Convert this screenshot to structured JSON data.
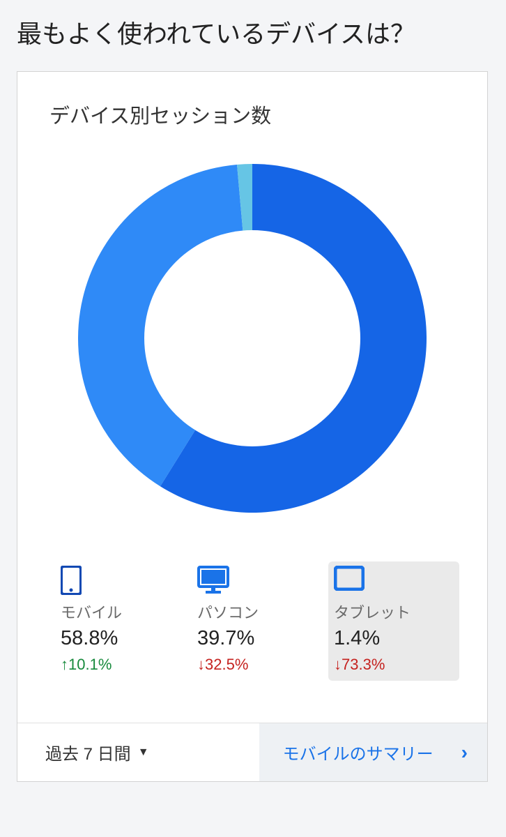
{
  "heading": "最もよく使われているデバイスは？",
  "card_title": "デバイス別セッション数",
  "segments": [
    {
      "key": "mobile",
      "label": "モバイル",
      "icon": "mobile-icon",
      "percent": "58.8%",
      "change": "10.1%",
      "direction": "up",
      "color": "#1565e6"
    },
    {
      "key": "desktop",
      "label": "パソコン",
      "icon": "desktop-icon",
      "percent": "39.7%",
      "change": "32.5%",
      "direction": "down",
      "color": "#2f8af7"
    },
    {
      "key": "tablet",
      "label": "タブレット",
      "icon": "tablet-icon",
      "percent": "1.4%",
      "change": "73.3%",
      "direction": "down",
      "color": "#66c5e5",
      "highlight": true
    }
  ],
  "footer": {
    "range_label": "過去 7 日間",
    "link_label": "モバイルのサマリー"
  },
  "chart_data": {
    "type": "pie",
    "title": "デバイス別セッション数",
    "categories": [
      "モバイル",
      "パソコン",
      "タブレット"
    ],
    "values": [
      58.8,
      39.7,
      1.4
    ],
    "series": [
      {
        "name": "モバイル",
        "values": [
          58.8
        ],
        "color": "#1565e6"
      },
      {
        "name": "パソコン",
        "values": [
          39.7
        ],
        "color": "#2f8af7"
      },
      {
        "name": "タブレット",
        "values": [
          1.4
        ],
        "color": "#66c5e5"
      }
    ],
    "donut": true,
    "inner_radius_ratio": 0.62
  }
}
